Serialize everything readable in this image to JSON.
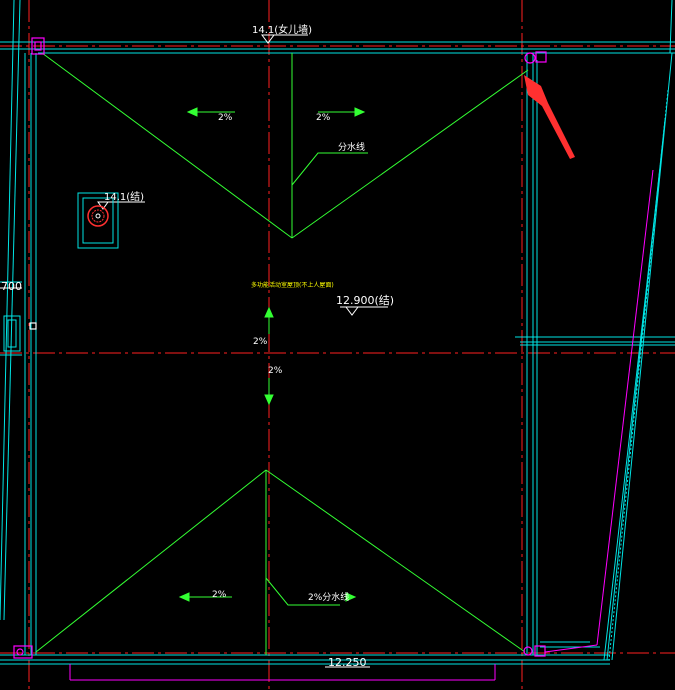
{
  "drawing": {
    "labels": {
      "parapet_top_elev": "14.1(女儿墙)",
      "box_elev": "14.1(结)",
      "left_dim": "700",
      "slope_tl": "2%",
      "slope_tr": "2%",
      "ridge_top": "分水线",
      "roof_note": "多功能活动室屋顶(不上人屋面)",
      "struct_elev": "12.900(结)",
      "slope_mid_up": "2%",
      "slope_mid_down": "2%",
      "slope_bl": "2%",
      "ridge_bottom": "2%分水线",
      "bottom_elev": "12.250"
    },
    "colors": {
      "background": "#000000",
      "wall_line": "#00ffff",
      "axis_line": "#ff0000",
      "roof_line": "#00ff00",
      "text_white": "#ffffff",
      "text_yellow": "#ffff00",
      "pipe_marker": "#ff00ff",
      "annotation_arrow": "#ff3030"
    }
  }
}
